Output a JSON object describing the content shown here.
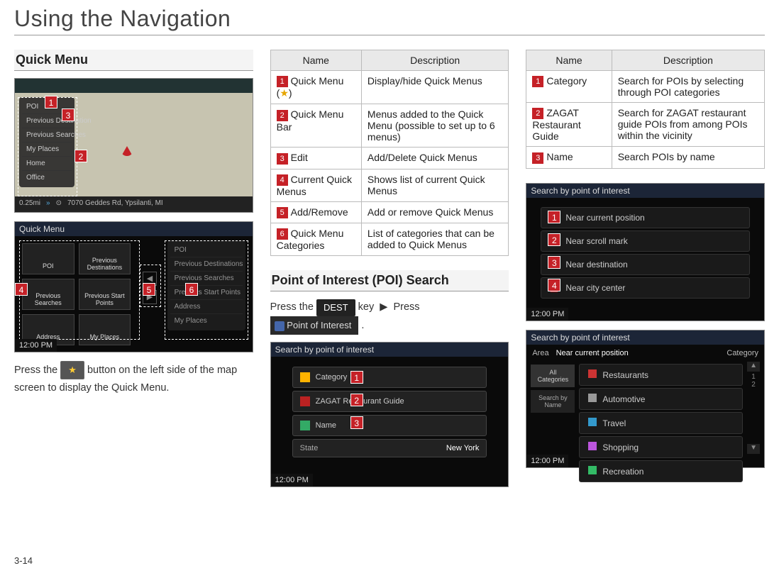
{
  "page": {
    "title": "Using the Navigation",
    "number": "3-14"
  },
  "col1": {
    "section_title": "Quick Menu",
    "map_shot": {
      "topbar_text": "",
      "bottombar_text": "7070 Geddes Rd, Ypsilanti, MI",
      "scale": "0.25mi",
      "badge1": "1",
      "badge2": "2",
      "badge3": "3",
      "sidebar_items": [
        "POI",
        "Previous Destination",
        "Previous Searches",
        "My Places",
        "Home",
        "Office"
      ]
    },
    "qm_shot": {
      "title": "Quick Menu",
      "badge4": "4",
      "badge5": "5",
      "badge6": "6",
      "clock": "12:00 PM",
      "left_items": [
        "POI",
        "Previous Destinations",
        "Previous Searches",
        "Address"
      ],
      "right_items": [
        "Previous Start Points",
        "My Places"
      ],
      "far_items": [
        "POI",
        "Previous Destinations",
        "Previous Searches",
        "Previous Start Points",
        "Address",
        "My Places"
      ]
    },
    "body_prefix": "Press the ",
    "body_mid": " button on the left side of the map screen to display the Quick Menu.",
    "star": "★"
  },
  "col2": {
    "table_headers": {
      "name": "Name",
      "desc": "Description"
    },
    "rows": [
      {
        "n": "1",
        "name_prefix": "Quick Menu (",
        "name_star": "★",
        "name_suffix": ")",
        "desc": "Display/hide Quick Menus"
      },
      {
        "n": "2",
        "name": "Quick Menu Bar",
        "desc": "Menus added to the Quick Menu (possible to set up to 6 menus)"
      },
      {
        "n": "3",
        "name": "Edit",
        "desc": "Add/Delete Quick Menus"
      },
      {
        "n": "4",
        "name": "Current Quick Menus",
        "desc": "Shows list of current Quick Menus"
      },
      {
        "n": "5",
        "name": "Add/Remove",
        "desc": "Add or remove Quick Menus"
      },
      {
        "n": "6",
        "name": "Quick Menu Categories",
        "desc": "List of categories that can be added to Quick Menus"
      }
    ],
    "poi_section_title": "Point of Interest (POI) Search",
    "poi_body_prefix": "Press the ",
    "poi_key": "DEST",
    "poi_body_mid": " key ",
    "poi_arrow": "▶",
    "poi_body_mid2": " Press",
    "poi_button_label": "Point of Interest",
    "poi_body_end": " .",
    "poi_shot": {
      "title": "Search by point of interest",
      "badge1": "1",
      "badge2": "2",
      "badge3": "3",
      "rows": [
        "Category",
        "ZAGAT Restaurant Guide",
        "Name"
      ],
      "state_label": "State",
      "state_value": "New York",
      "clock": "12:00 PM"
    }
  },
  "col3": {
    "table_headers": {
      "name": "Name",
      "desc": "Description"
    },
    "rows": [
      {
        "n": "1",
        "name": "Category",
        "desc": "Search for POIs by selecting through POI categories"
      },
      {
        "n": "2",
        "name": "ZAGAT Restaurant Guide",
        "desc": "Search for ZAGAT restaurant guide POIs from among POIs within the vicinity"
      },
      {
        "n": "3",
        "name": "Name",
        "desc": "Search POIs by name"
      }
    ],
    "list_shot": {
      "title": "Search by point of interest",
      "badges": [
        "1",
        "2",
        "3",
        "4"
      ],
      "items": [
        "Near current position",
        "Near scroll mark",
        "Near destination",
        "Near city center"
      ],
      "clock": "12:00 PM"
    },
    "cat_shot": {
      "title": "Search by point of interest",
      "area_label": "Area",
      "area_value": "Near current position",
      "category_label": "Category",
      "side_buttons": [
        "All Categories",
        "Search by Name"
      ],
      "categories": [
        "Restaurants",
        "Automotive",
        "Travel",
        "Shopping",
        "Recreation"
      ],
      "pager": "1\n2",
      "clock": "12:00 PM"
    }
  }
}
